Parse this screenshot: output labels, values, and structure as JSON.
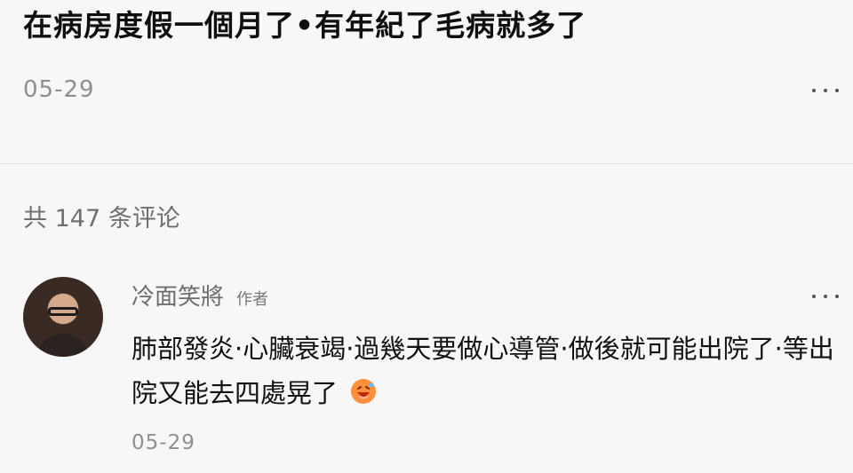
{
  "post": {
    "title": "在病房度假一個月了•有年紀了毛病就多了",
    "date": "05-29"
  },
  "comments_header": {
    "count_text": "共 147 条评论"
  },
  "comment": {
    "username": "冷面笑將",
    "author_tag": "作者",
    "text": "肺部發炎·心臟衰竭·過幾天要做心導管·做後就可能出院了·等出院又能去四處晃了",
    "date": "05-29",
    "emoji_icon": "laughing-face-icon"
  }
}
